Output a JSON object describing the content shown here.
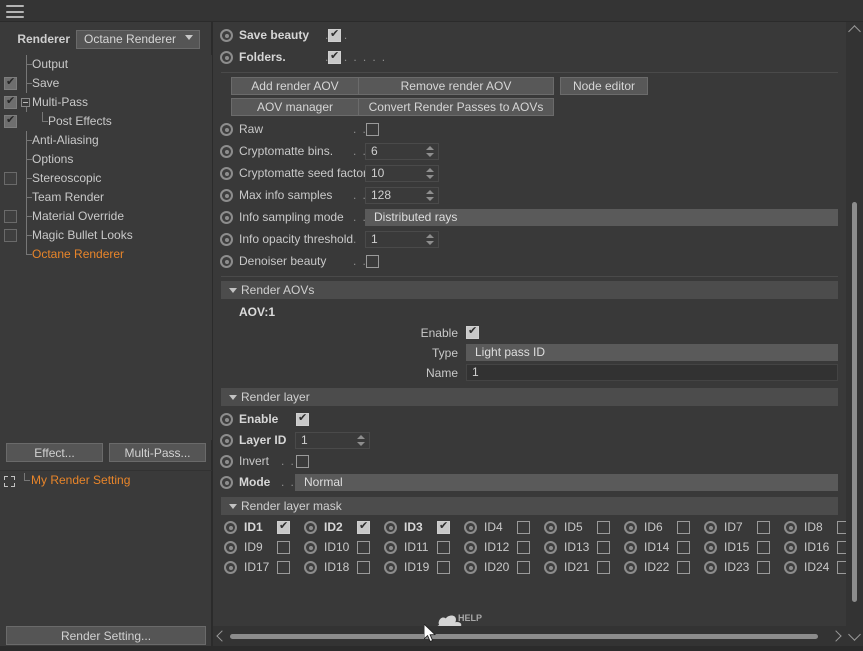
{
  "topbar": {
    "menu_icon": "hamburger-icon"
  },
  "left_panel": {
    "renderer_label": "Renderer",
    "renderer_value": "Octane Renderer",
    "tree": [
      {
        "label": "Output",
        "checkbox": "none",
        "indent": 1
      },
      {
        "label": "Save",
        "checkbox": "on",
        "indent": 1
      },
      {
        "label": "Multi-Pass",
        "checkbox": "on",
        "indent": 1,
        "expander": "minus"
      },
      {
        "label": "Post Effects",
        "checkbox": "on",
        "indent": 2
      },
      {
        "label": "Anti-Aliasing",
        "checkbox": "none",
        "indent": 1
      },
      {
        "label": "Options",
        "checkbox": "none",
        "indent": 1
      },
      {
        "label": "Stereoscopic",
        "checkbox": "off",
        "indent": 1
      },
      {
        "label": "Team Render",
        "checkbox": "none",
        "indent": 1
      },
      {
        "label": "Material Override",
        "checkbox": "off",
        "indent": 1
      },
      {
        "label": "Magic Bullet Looks",
        "checkbox": "off",
        "indent": 1
      },
      {
        "label": "Octane Renderer",
        "checkbox": "none",
        "indent": 1,
        "selected": true
      }
    ],
    "effect_button": "Effect...",
    "multipass_button": "Multi-Pass...",
    "render_setting_name": "My Render Setting",
    "render_setting_button": "Render Setting...",
    "selected_color": "#e8852a"
  },
  "right_panel": {
    "top_toggles": [
      {
        "label": "Save beauty",
        "dots": ". . .",
        "checked": true
      },
      {
        "label": "Folders.",
        "dots": ". . . . . . .",
        "checked": true
      }
    ],
    "buttons": [
      {
        "label": "Add render AOV"
      },
      {
        "label": "Remove render AOV"
      },
      {
        "label": "Node editor"
      },
      {
        "label": "AOV manager"
      },
      {
        "label": "Convert Render Passes to AOVs"
      }
    ],
    "params": [
      {
        "label": "Raw",
        "dots": ". . . . . . . . . . . . .",
        "type": "checkbox",
        "value": false
      },
      {
        "label": "Cryptomatte bins.",
        "dots": ". . . . .",
        "type": "number",
        "value": "6"
      },
      {
        "label": "Cryptomatte seed factor",
        "dots": "",
        "type": "number",
        "value": "10"
      },
      {
        "label": "Max info samples",
        "dots": ". . . .",
        "type": "number",
        "value": "128"
      },
      {
        "label": "Info sampling mode",
        "dots": ". .",
        "type": "dropdown",
        "value": "Distributed rays"
      },
      {
        "label": "Info opacity threshold",
        "dots": ".",
        "type": "number",
        "value": "1"
      },
      {
        "label": "Denoiser beauty",
        "dots": ". . . . .",
        "type": "checkbox",
        "value": false
      }
    ],
    "render_aovs": {
      "header": "Render AOVs",
      "aov_title": "AOV:1",
      "enable_label": "Enable",
      "enable_value": true,
      "type_label": "Type",
      "type_value": "Light pass ID",
      "name_label": "Name",
      "name_value": "1"
    },
    "render_layer": {
      "header": "Render layer",
      "rows": [
        {
          "label": "Enable",
          "dots": "",
          "type": "checkbox",
          "value": true,
          "bold": true
        },
        {
          "label": "Layer ID",
          "dots": "",
          "type": "number",
          "value": "1",
          "bold": true
        },
        {
          "label": "Invert",
          "dots": ". .",
          "type": "checkbox",
          "value": false,
          "bold": false
        },
        {
          "label": "Mode",
          "dots": ". .",
          "type": "dropdown",
          "value": "Normal",
          "bold": true
        }
      ]
    },
    "render_layer_mask": {
      "header": "Render layer mask",
      "ids": [
        {
          "label": "ID1",
          "checked": true
        },
        {
          "label": "ID2",
          "checked": true
        },
        {
          "label": "ID3",
          "checked": true
        },
        {
          "label": "ID4",
          "checked": false
        },
        {
          "label": "ID5",
          "checked": false
        },
        {
          "label": "ID6",
          "checked": false
        },
        {
          "label": "ID7",
          "checked": false
        },
        {
          "label": "ID8",
          "checked": false
        },
        {
          "label": "ID9",
          "checked": false
        },
        {
          "label": "ID10",
          "checked": false
        },
        {
          "label": "ID11",
          "checked": false
        },
        {
          "label": "ID12",
          "checked": false
        },
        {
          "label": "ID13",
          "checked": false
        },
        {
          "label": "ID14",
          "checked": false
        },
        {
          "label": "ID15",
          "checked": false
        },
        {
          "label": "ID16",
          "checked": false
        },
        {
          "label": "ID17",
          "checked": false
        },
        {
          "label": "ID18",
          "checked": false
        },
        {
          "label": "ID19",
          "checked": false
        },
        {
          "label": "ID20",
          "checked": false
        },
        {
          "label": "ID21",
          "checked": false
        },
        {
          "label": "ID22",
          "checked": false
        },
        {
          "label": "ID23",
          "checked": false
        },
        {
          "label": "ID24",
          "checked": false
        }
      ]
    },
    "help": {
      "label": "HELP",
      "logo": "octane-logo-icon"
    }
  },
  "scrollbars": {
    "vertical": "vertical-scrollbar",
    "horizontal": "horizontal-scrollbar"
  }
}
